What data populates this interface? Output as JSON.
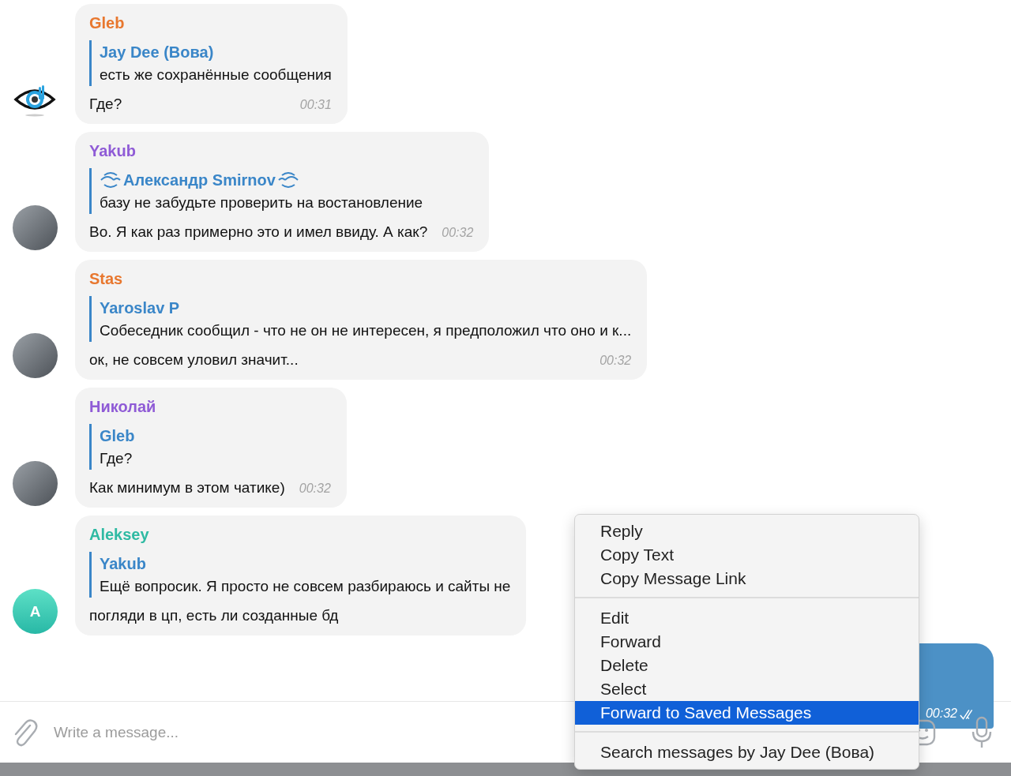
{
  "messages": [
    {
      "avatar": {
        "kind": "logo"
      },
      "sender": {
        "name": "Gleb",
        "color": "#e8772e"
      },
      "reply": {
        "author": "Jay Dee (Вова)",
        "decorated": false,
        "text": "есть же сохранённые сообщения"
      },
      "text": "Где?",
      "time": "00:31"
    },
    {
      "avatar": {
        "kind": "photo"
      },
      "sender": {
        "name": "Yakub",
        "color": "#8f5bd6"
      },
      "reply": {
        "author": "Александр Smirnov",
        "decorated": true,
        "text": "базу не забудьте проверить на востановление"
      },
      "text": "Во. Я как раз примерно это и имел ввиду. А как?",
      "time": "00:32"
    },
    {
      "avatar": {
        "kind": "photo"
      },
      "sender": {
        "name": "Stas",
        "color": "#e8772e"
      },
      "reply": {
        "author": "Yaroslav P",
        "decorated": false,
        "text": "Собеседник сообщил - что не он не интересен, я предположил что оно и к..."
      },
      "text": "ок, не совсем уловил значит...",
      "time": "00:32"
    },
    {
      "avatar": {
        "kind": "photo"
      },
      "sender": {
        "name": "Николай",
        "color": "#8f5bd6"
      },
      "reply": {
        "author": "Gleb",
        "decorated": false,
        "text": "Где?"
      },
      "text": "Как минимум в этом чатике)",
      "time": "00:32"
    },
    {
      "avatar": {
        "kind": "letter",
        "letter": "A"
      },
      "sender": {
        "name": "Aleksey",
        "color": "#2fbaa3"
      },
      "reply": {
        "author": "Yakub",
        "decorated": false,
        "text": "Ещё вопросик. Я просто не совсем разбираюсь и сайты не"
      },
      "text": "погляди в цп, есть ли созданные бд"
    }
  ],
  "outgoing": {
    "time": "00:32",
    "read": true
  },
  "composer": {
    "placeholder": "Write a message..."
  },
  "context_menu": {
    "sections": [
      [
        {
          "label": "Reply",
          "selected": false
        },
        {
          "label": "Copy Text",
          "selected": false
        },
        {
          "label": "Copy Message Link",
          "selected": false
        }
      ],
      [
        {
          "label": "Edit",
          "selected": false
        },
        {
          "label": "Forward",
          "selected": false
        },
        {
          "label": "Delete",
          "selected": false
        },
        {
          "label": "Select",
          "selected": false
        },
        {
          "label": "Forward to Saved Messages",
          "selected": true
        }
      ],
      [
        {
          "label": "Search messages by Jay Dee (Вова)",
          "selected": false
        }
      ]
    ]
  }
}
